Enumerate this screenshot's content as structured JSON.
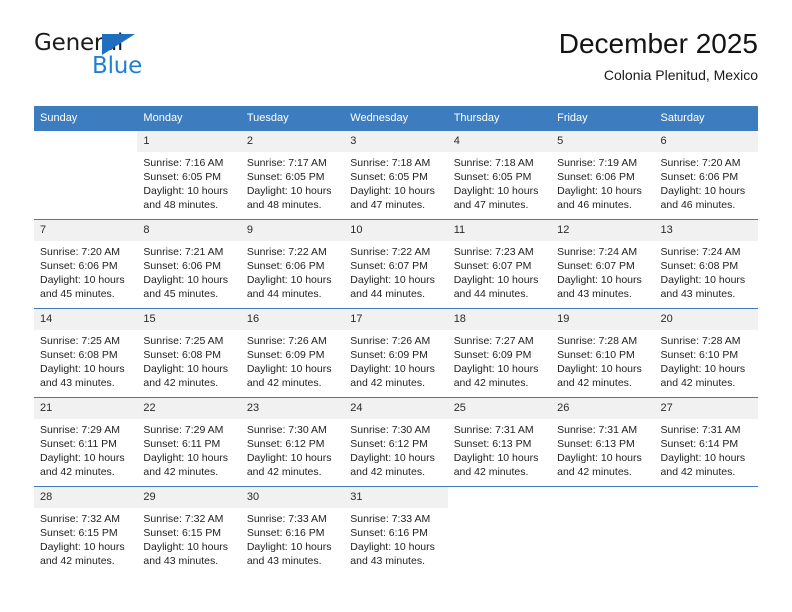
{
  "brand": {
    "name_top": "General",
    "name_bottom": "Blue",
    "triangle_color": "#1f6fc0",
    "blue_color": "#1f7fd4"
  },
  "header": {
    "title": "December 2025",
    "subtitle": "Colonia Plenitud, Mexico"
  },
  "theme": {
    "header_blue": "#3d7dbf",
    "daynum_band": "#f1f1f1",
    "text": "#222222"
  },
  "weekdays": [
    "Sunday",
    "Monday",
    "Tuesday",
    "Wednesday",
    "Thursday",
    "Friday",
    "Saturday"
  ],
  "labels": {
    "sunrise_prefix": "Sunrise:",
    "sunset_prefix": "Sunset:",
    "daylight_prefix": "Daylight:"
  },
  "weeks": [
    [
      {
        "day": "",
        "line1": "",
        "line2": "",
        "line3": "",
        "line4": ""
      },
      {
        "day": "1",
        "line1": "Sunrise: 7:16 AM",
        "line2": "Sunset: 6:05 PM",
        "line3": "Daylight: 10 hours",
        "line4": "and 48 minutes."
      },
      {
        "day": "2",
        "line1": "Sunrise: 7:17 AM",
        "line2": "Sunset: 6:05 PM",
        "line3": "Daylight: 10 hours",
        "line4": "and 48 minutes."
      },
      {
        "day": "3",
        "line1": "Sunrise: 7:18 AM",
        "line2": "Sunset: 6:05 PM",
        "line3": "Daylight: 10 hours",
        "line4": "and 47 minutes."
      },
      {
        "day": "4",
        "line1": "Sunrise: 7:18 AM",
        "line2": "Sunset: 6:05 PM",
        "line3": "Daylight: 10 hours",
        "line4": "and 47 minutes."
      },
      {
        "day": "5",
        "line1": "Sunrise: 7:19 AM",
        "line2": "Sunset: 6:06 PM",
        "line3": "Daylight: 10 hours",
        "line4": "and 46 minutes."
      },
      {
        "day": "6",
        "line1": "Sunrise: 7:20 AM",
        "line2": "Sunset: 6:06 PM",
        "line3": "Daylight: 10 hours",
        "line4": "and 46 minutes."
      }
    ],
    [
      {
        "day": "7",
        "line1": "Sunrise: 7:20 AM",
        "line2": "Sunset: 6:06 PM",
        "line3": "Daylight: 10 hours",
        "line4": "and 45 minutes."
      },
      {
        "day": "8",
        "line1": "Sunrise: 7:21 AM",
        "line2": "Sunset: 6:06 PM",
        "line3": "Daylight: 10 hours",
        "line4": "and 45 minutes."
      },
      {
        "day": "9",
        "line1": "Sunrise: 7:22 AM",
        "line2": "Sunset: 6:06 PM",
        "line3": "Daylight: 10 hours",
        "line4": "and 44 minutes."
      },
      {
        "day": "10",
        "line1": "Sunrise: 7:22 AM",
        "line2": "Sunset: 6:07 PM",
        "line3": "Daylight: 10 hours",
        "line4": "and 44 minutes."
      },
      {
        "day": "11",
        "line1": "Sunrise: 7:23 AM",
        "line2": "Sunset: 6:07 PM",
        "line3": "Daylight: 10 hours",
        "line4": "and 44 minutes."
      },
      {
        "day": "12",
        "line1": "Sunrise: 7:24 AM",
        "line2": "Sunset: 6:07 PM",
        "line3": "Daylight: 10 hours",
        "line4": "and 43 minutes."
      },
      {
        "day": "13",
        "line1": "Sunrise: 7:24 AM",
        "line2": "Sunset: 6:08 PM",
        "line3": "Daylight: 10 hours",
        "line4": "and 43 minutes."
      }
    ],
    [
      {
        "day": "14",
        "line1": "Sunrise: 7:25 AM",
        "line2": "Sunset: 6:08 PM",
        "line3": "Daylight: 10 hours",
        "line4": "and 43 minutes."
      },
      {
        "day": "15",
        "line1": "Sunrise: 7:25 AM",
        "line2": "Sunset: 6:08 PM",
        "line3": "Daylight: 10 hours",
        "line4": "and 42 minutes."
      },
      {
        "day": "16",
        "line1": "Sunrise: 7:26 AM",
        "line2": "Sunset: 6:09 PM",
        "line3": "Daylight: 10 hours",
        "line4": "and 42 minutes."
      },
      {
        "day": "17",
        "line1": "Sunrise: 7:26 AM",
        "line2": "Sunset: 6:09 PM",
        "line3": "Daylight: 10 hours",
        "line4": "and 42 minutes."
      },
      {
        "day": "18",
        "line1": "Sunrise: 7:27 AM",
        "line2": "Sunset: 6:09 PM",
        "line3": "Daylight: 10 hours",
        "line4": "and 42 minutes."
      },
      {
        "day": "19",
        "line1": "Sunrise: 7:28 AM",
        "line2": "Sunset: 6:10 PM",
        "line3": "Daylight: 10 hours",
        "line4": "and 42 minutes."
      },
      {
        "day": "20",
        "line1": "Sunrise: 7:28 AM",
        "line2": "Sunset: 6:10 PM",
        "line3": "Daylight: 10 hours",
        "line4": "and 42 minutes."
      }
    ],
    [
      {
        "day": "21",
        "line1": "Sunrise: 7:29 AM",
        "line2": "Sunset: 6:11 PM",
        "line3": "Daylight: 10 hours",
        "line4": "and 42 minutes."
      },
      {
        "day": "22",
        "line1": "Sunrise: 7:29 AM",
        "line2": "Sunset: 6:11 PM",
        "line3": "Daylight: 10 hours",
        "line4": "and 42 minutes."
      },
      {
        "day": "23",
        "line1": "Sunrise: 7:30 AM",
        "line2": "Sunset: 6:12 PM",
        "line3": "Daylight: 10 hours",
        "line4": "and 42 minutes."
      },
      {
        "day": "24",
        "line1": "Sunrise: 7:30 AM",
        "line2": "Sunset: 6:12 PM",
        "line3": "Daylight: 10 hours",
        "line4": "and 42 minutes."
      },
      {
        "day": "25",
        "line1": "Sunrise: 7:31 AM",
        "line2": "Sunset: 6:13 PM",
        "line3": "Daylight: 10 hours",
        "line4": "and 42 minutes."
      },
      {
        "day": "26",
        "line1": "Sunrise: 7:31 AM",
        "line2": "Sunset: 6:13 PM",
        "line3": "Daylight: 10 hours",
        "line4": "and 42 minutes."
      },
      {
        "day": "27",
        "line1": "Sunrise: 7:31 AM",
        "line2": "Sunset: 6:14 PM",
        "line3": "Daylight: 10 hours",
        "line4": "and 42 minutes."
      }
    ],
    [
      {
        "day": "28",
        "line1": "Sunrise: 7:32 AM",
        "line2": "Sunset: 6:15 PM",
        "line3": "Daylight: 10 hours",
        "line4": "and 42 minutes."
      },
      {
        "day": "29",
        "line1": "Sunrise: 7:32 AM",
        "line2": "Sunset: 6:15 PM",
        "line3": "Daylight: 10 hours",
        "line4": "and 43 minutes."
      },
      {
        "day": "30",
        "line1": "Sunrise: 7:33 AM",
        "line2": "Sunset: 6:16 PM",
        "line3": "Daylight: 10 hours",
        "line4": "and 43 minutes."
      },
      {
        "day": "31",
        "line1": "Sunrise: 7:33 AM",
        "line2": "Sunset: 6:16 PM",
        "line3": "Daylight: 10 hours",
        "line4": "and 43 minutes."
      },
      {
        "day": "",
        "line1": "",
        "line2": "",
        "line3": "",
        "line4": ""
      },
      {
        "day": "",
        "line1": "",
        "line2": "",
        "line3": "",
        "line4": ""
      },
      {
        "day": "",
        "line1": "",
        "line2": "",
        "line3": "",
        "line4": ""
      }
    ]
  ]
}
